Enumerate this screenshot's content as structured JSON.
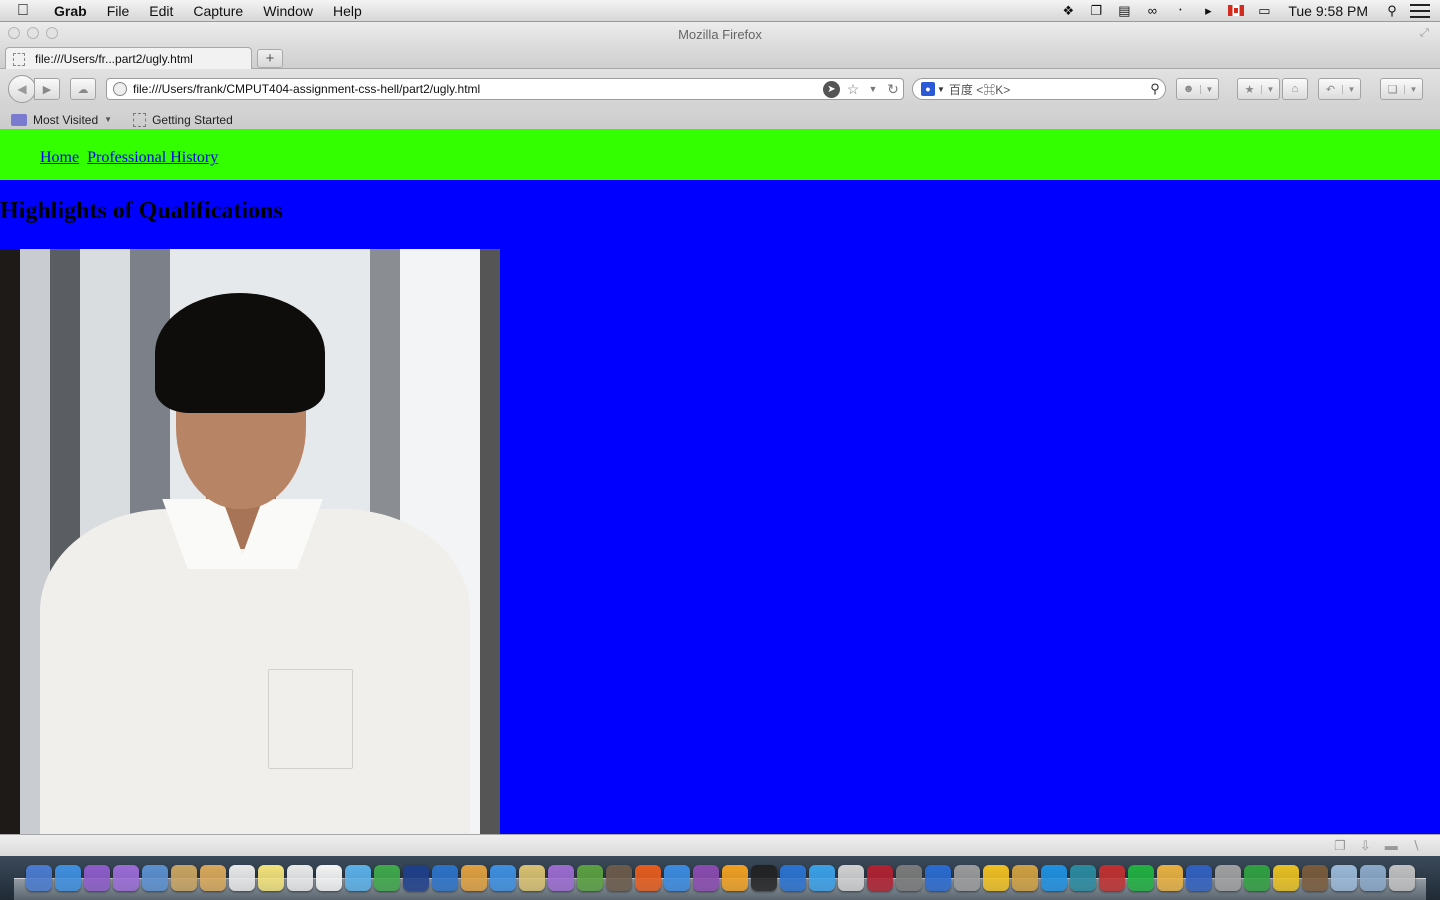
{
  "menubar": {
    "app_name": "Grab",
    "menus": [
      "File",
      "Edit",
      "Capture",
      "Window",
      "Help"
    ],
    "clock": "Tue 9:58 PM"
  },
  "window": {
    "title": "Mozilla Firefox"
  },
  "tabs": [
    {
      "label": "file:///Users/fr...part2/ugly.html",
      "active": true
    }
  ],
  "newtab_label": "+",
  "urlbar": {
    "value": "file:///Users/frank/CMPUT404-assignment-css-hell/part2/ugly.html"
  },
  "searchbar": {
    "placeholder": "百度 <⌘K>"
  },
  "bookmarks": {
    "items": [
      "Most Visited",
      "Getting Started"
    ]
  },
  "page": {
    "background": "#0000ff",
    "nav_background": "#33ff00",
    "nav_links": [
      "Home",
      "Professional History"
    ],
    "heading": "Highlights of Qualifications"
  },
  "dock": {
    "icon_colors": [
      "#4a7bd0",
      "#3e8fe0",
      "#8d5bc9",
      "#9a6bd6",
      "#5b8fcf",
      "#c9a460",
      "#d8a85a",
      "#e8e8e8",
      "#f2e27a",
      "#e9e9e9",
      "#f4f4f4",
      "#5ab0e8",
      "#3fa84a",
      "#1e3e8a",
      "#2b72c8",
      "#e0a040",
      "#3d8fe0",
      "#d8c070",
      "#9b6bd0",
      "#5aa040",
      "#6b5a4a",
      "#e65c1c",
      "#3a8ae0",
      "#8a4ab0",
      "#f0a020",
      "#222222",
      "#2a72d0",
      "#3aa0e8",
      "#d0d0d0",
      "#b02030",
      "#7a7a7a",
      "#2a6ad0",
      "#9a9a9a",
      "#f0c020",
      "#d0a040",
      "#1e90e0",
      "#2a8aa0",
      "#c03030",
      "#20b040",
      "#e8b040",
      "#3060c0",
      "#a0a0a0",
      "#30a040",
      "#e8c020",
      "#7a5a3a",
      "#9ab8d8",
      "#8aa8c8",
      "#c0c0c0"
    ]
  }
}
